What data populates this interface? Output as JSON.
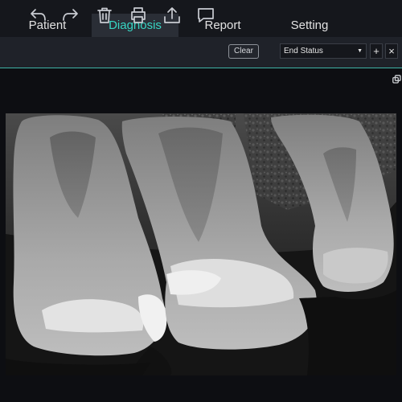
{
  "tabs": [
    {
      "label": "Patient",
      "active": false
    },
    {
      "label": "Diagnosis",
      "active": true
    },
    {
      "label": "Report",
      "active": false
    },
    {
      "label": "Setting",
      "active": false
    }
  ],
  "toolbar": {
    "tools": [
      "undo-icon",
      "redo-icon",
      "trash-icon",
      "print-icon",
      "upload-icon",
      "comment-icon"
    ],
    "clear_label": "Clear",
    "status_select": {
      "value": "End Status"
    },
    "add_label": "+",
    "close_label": "×"
  },
  "viewer": {
    "image_type": "dental periapical radiograph",
    "restore_icon": "restore-window-icon"
  },
  "colors": {
    "accent": "#37d6c4",
    "tabbar_bg": "#15171c",
    "toolbar_bg": "#1f2229",
    "active_tab_bg": "#2a2e36",
    "workspace_bg": "#0d0e12"
  }
}
